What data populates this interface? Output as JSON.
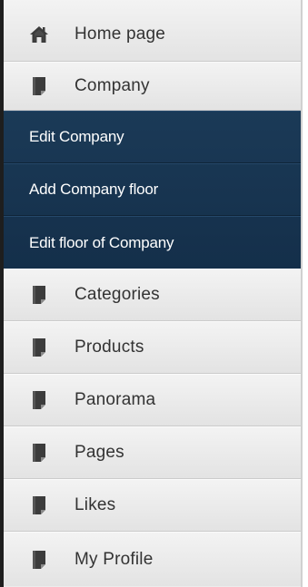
{
  "sidebar": {
    "items": [
      {
        "label": "Home page",
        "icon": "home-icon"
      },
      {
        "label": "Company",
        "icon": "page-icon",
        "expanded": true,
        "submenu": [
          {
            "label": "Edit Company"
          },
          {
            "label": "Add Company floor"
          },
          {
            "label": "Edit floor of Company"
          }
        ]
      },
      {
        "label": "Categories",
        "icon": "page-icon"
      },
      {
        "label": "Products",
        "icon": "page-icon"
      },
      {
        "label": "Panorama",
        "icon": "page-icon"
      },
      {
        "label": "Pages",
        "icon": "page-icon"
      },
      {
        "label": "Likes",
        "icon": "page-icon"
      },
      {
        "label": "My Profile",
        "icon": "page-icon"
      }
    ]
  },
  "colors": {
    "item_bg": "#ececec",
    "item_text": "#333333",
    "submenu_bg": "#1b3a57",
    "submenu_text": "#ffffff",
    "icon": "#3c3c3c"
  }
}
